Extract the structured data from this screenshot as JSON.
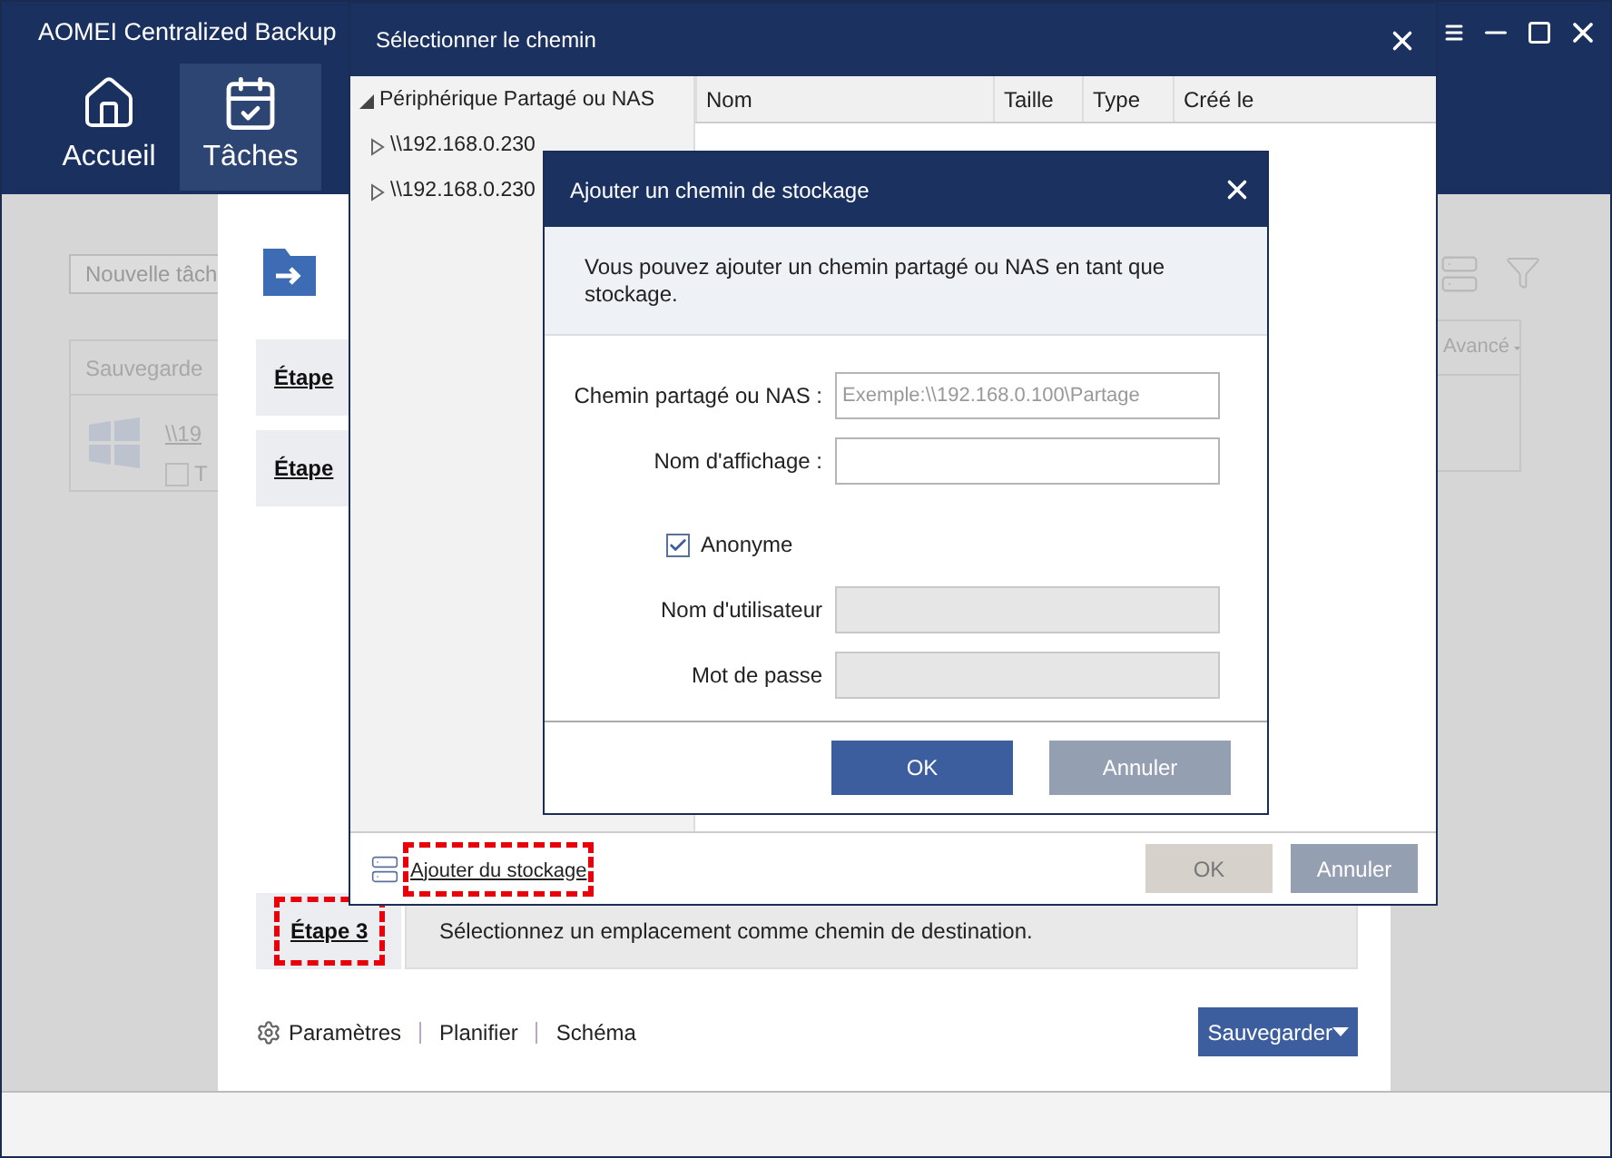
{
  "app": {
    "title": "AOMEI Centralized Backup",
    "nav": [
      {
        "label": "Accueil",
        "selected": false
      },
      {
        "label": "Tâches",
        "selected": true
      }
    ]
  },
  "background": {
    "search": {
      "placeholder": "Nouvelle tâch"
    },
    "table": {
      "header": "Sauvegarde",
      "link": "\\\\19",
      "checkbox_label": "T",
      "checked": false
    },
    "advanced": "Avancé"
  },
  "wizard": {
    "steps": [
      {
        "label": "Étape",
        "highlighted": false
      },
      {
        "label": "Étape",
        "highlighted": false
      },
      {
        "label": "Étape 3",
        "description": "Sélectionnez un emplacement comme chemin de destination.",
        "highlighted": true
      }
    ],
    "footer_links": [
      "Paramètres",
      "Planifier",
      "Schéma"
    ],
    "primary_button": "Sauvegarder"
  },
  "select_dialog": {
    "title": "Sélectionner le chemin",
    "tree": [
      {
        "label": "Périphérique Partagé ou NAS",
        "expanded": true,
        "children": [
          {
            "label": "\\\\192.168.0.230",
            "expanded": false
          },
          {
            "label": "\\\\192.168.0.230",
            "expanded": false
          }
        ]
      }
    ],
    "columns": [
      "Nom",
      "Taille",
      "Type",
      "Créé le"
    ],
    "add_link": {
      "label": "Ajouter du stockage",
      "highlighted": true
    },
    "buttons": [
      {
        "label": "OK",
        "disabled": true
      },
      {
        "label": "Annuler",
        "disabled": false
      }
    ]
  },
  "add_dialog": {
    "title": "Ajouter un chemin de stockage",
    "info": "Vous pouvez ajouter un chemin partagé ou NAS en tant que stockage.",
    "fields": [
      {
        "kind": "text",
        "label": "Chemin partagé ou NAS :",
        "placeholder": "Exemple:\\\\192.168.0.100\\Partage",
        "disabled": false
      },
      {
        "kind": "text",
        "label": "Nom d'affichage :",
        "disabled": false
      },
      {
        "kind": "checkbox",
        "label": "Anonyme",
        "checked": true
      },
      {
        "kind": "text",
        "label": "Nom d'utilisateur",
        "disabled": true
      },
      {
        "kind": "text",
        "label": "Mot de passe",
        "disabled": true
      }
    ],
    "buttons": [
      {
        "label": "OK",
        "primary": true
      },
      {
        "label": "Annuler",
        "primary": false
      }
    ]
  }
}
